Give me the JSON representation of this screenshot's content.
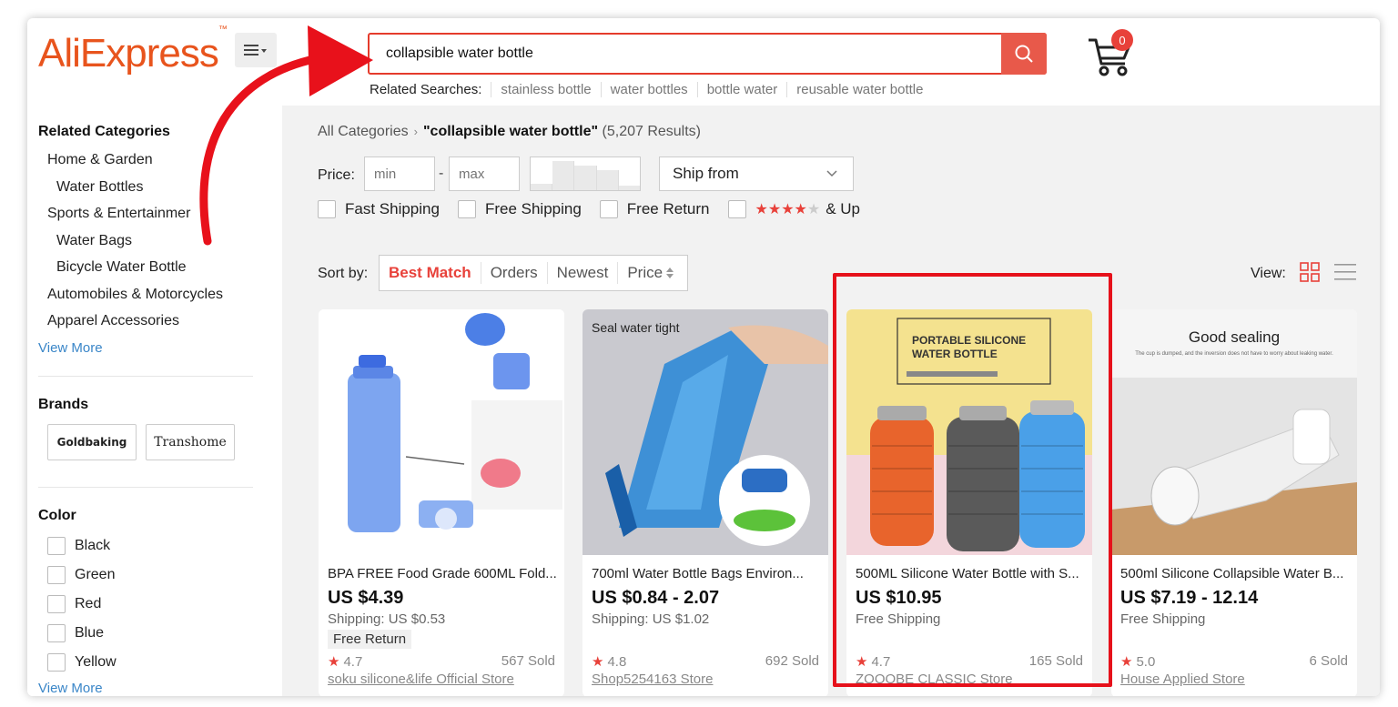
{
  "header": {
    "logo": "AliExpress",
    "logo_tm": "™",
    "search_value": "collapsible water bottle",
    "related_label": "Related Searches:",
    "related_searches": [
      "stainless bottle",
      "water bottles",
      "bottle water",
      "reusable water bottle"
    ],
    "cart_count": "0"
  },
  "sidebar": {
    "categories_title": "Related Categories",
    "categories": [
      "Home & Garden",
      "Water Bottles",
      "Sports & Entertainmer",
      "Water Bags",
      "Bicycle Water Bottle",
      "Automobiles & Motorcycles",
      "Apparel Accessories"
    ],
    "view_more": "View More",
    "brands_title": "Brands",
    "brands": [
      "Goldbaking",
      "Transhome"
    ],
    "color_title": "Color",
    "colors": [
      "Black",
      "Green",
      "Red",
      "Blue",
      "Yellow"
    ],
    "color_view_more": "View More"
  },
  "main": {
    "breadcrumb_root": "All Categories",
    "breadcrumb_sep": "›",
    "query_label": "\"collapsible water bottle\"",
    "results_count": "(5,207 Results)",
    "price_label": "Price:",
    "min_placeholder": "min",
    "max_placeholder": "max",
    "price_dash": "-",
    "ship_from": "Ship from",
    "filters": [
      "Fast Shipping",
      "Free Shipping",
      "Free Return"
    ],
    "stars_and_up": "& Up",
    "sort_label": "Sort by:",
    "sort_options": [
      "Best Match",
      "Orders",
      "Newest",
      "Price"
    ],
    "view_label": "View:"
  },
  "products": [
    {
      "title": "BPA FREE Food Grade 600ML Fold...",
      "price": "US $4.39",
      "shipping": "Shipping: US $0.53",
      "free_return": "Free Return",
      "rating": "4.7",
      "sold": "567 Sold",
      "store": "soku silicone&life Official Store"
    },
    {
      "title": "700ml Water Bottle Bags Environ...",
      "price": "US $0.84 - 2.07",
      "shipping": "Shipping: US $1.02",
      "rating": "4.8",
      "sold": "692 Sold",
      "store": "Shop5254163 Store",
      "image_text": "Seal water tight"
    },
    {
      "title": "500ML Silicone Water Bottle with S...",
      "price": "US $10.95",
      "shipping": "Free Shipping",
      "rating": "4.7",
      "sold": "165 Sold",
      "store": "ZOOOBE CLASSIC Store",
      "image_text": "PORTABLE SILICONE WATER BOTTLE"
    },
    {
      "title": "500ml Silicone Collapsible Water B...",
      "price": "US $7.19 - 12.14",
      "shipping": "Free Shipping",
      "rating": "5.0",
      "sold": "6 Sold",
      "store": "House Applied Store",
      "image_text": "Good sealing",
      "image_subtext": "The cup is dumped, and the inversion does not have to worry about leaking water."
    }
  ],
  "colors": {
    "accent": "#e8413a",
    "logo": "#e8541d",
    "link": "#3a86c8",
    "highlight": "#e6111b"
  }
}
